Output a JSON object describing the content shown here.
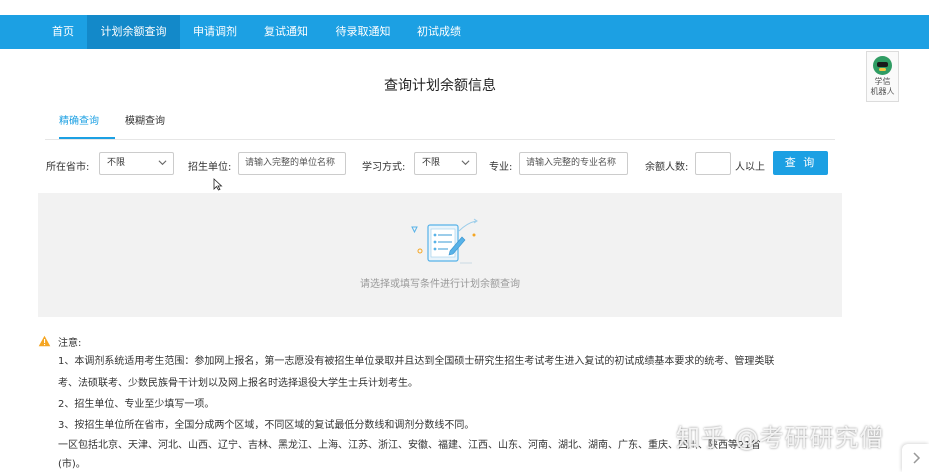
{
  "nav": {
    "items": [
      {
        "label": "首页",
        "active": false
      },
      {
        "label": "计划余额查询",
        "active": true
      },
      {
        "label": "申请调剂",
        "active": false
      },
      {
        "label": "复试通知",
        "active": false
      },
      {
        "label": "待录取通知",
        "active": false
      },
      {
        "label": "初试成绩",
        "active": false
      }
    ]
  },
  "robot": {
    "line1": "学信",
    "line2": "机器人"
  },
  "page": {
    "title": "查询计划余额信息"
  },
  "tabs": [
    {
      "label": "精确查询",
      "active": true
    },
    {
      "label": "模糊查询",
      "active": false
    }
  ],
  "filters": {
    "province_label": "所在省市:",
    "province_value": "不限",
    "unit_label": "招生单位:",
    "unit_placeholder": "请输入完整的单位名称",
    "mode_label": "学习方式:",
    "mode_value": "不限",
    "major_label": "专业:",
    "major_placeholder": "请输入完整的专业名称",
    "quota_label": "余额人数:",
    "quota_value": "",
    "quota_suffix": "人以上",
    "query_button": "查 询"
  },
  "empty": {
    "text": "请选择或填写条件进行计划余额查询"
  },
  "note": {
    "title": "注意:",
    "lines": [
      "1、本调剂系统适用考生范围：参加网上报名，第一志愿没有被招生单位录取并且达到全国硕士研究生招生考试考生进入复试的初试成绩基本要求的统考、管理类联",
      "考、法硕联考、少数民族骨干计划以及网上报名时选择退役大学生士兵计划考生。",
      "2、招生单位、专业至少填写一项。",
      "3、按招生单位所在省市，全国分成两个区域，不同区域的复试最低分数线和调剂分数线不同。",
      "一区包括北京、天津、河北、山西、辽宁、吉林、黑龙江、上海、江苏、浙江、安徽、福建、江西、山东、河南、湖北、湖南、广东、重庆、四川、陕西等21省",
      "(市)。"
    ]
  },
  "watermark": "知乎 @考研研究僧",
  "colors": {
    "brand": "#1ca0e3",
    "nav_active": "#1389c9",
    "panel": "#f2f2f2",
    "warning": "#f5a623"
  }
}
